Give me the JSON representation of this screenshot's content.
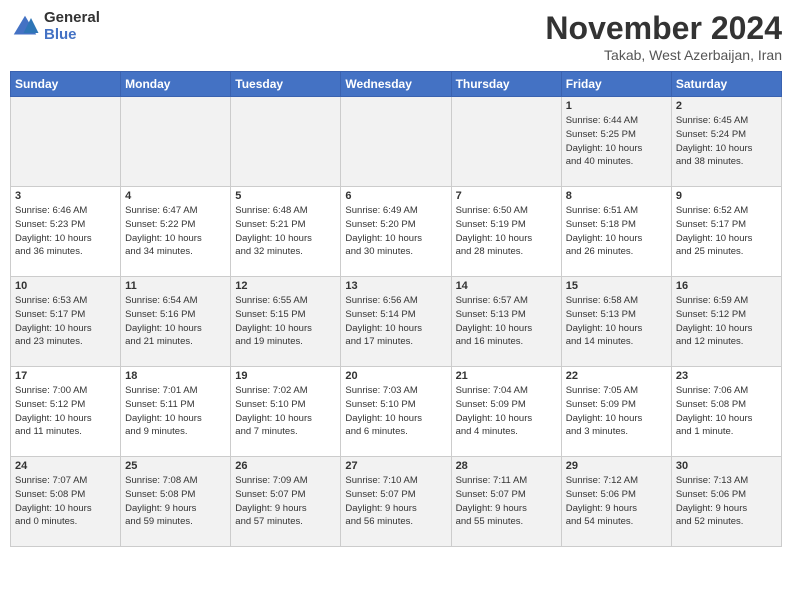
{
  "header": {
    "logo_line1": "General",
    "logo_line2": "Blue",
    "month": "November 2024",
    "location": "Takab, West Azerbaijan, Iran"
  },
  "weekdays": [
    "Sunday",
    "Monday",
    "Tuesday",
    "Wednesday",
    "Thursday",
    "Friday",
    "Saturday"
  ],
  "weeks": [
    [
      {
        "day": "",
        "info": ""
      },
      {
        "day": "",
        "info": ""
      },
      {
        "day": "",
        "info": ""
      },
      {
        "day": "",
        "info": ""
      },
      {
        "day": "",
        "info": ""
      },
      {
        "day": "1",
        "info": "Sunrise: 6:44 AM\nSunset: 5:25 PM\nDaylight: 10 hours\nand 40 minutes."
      },
      {
        "day": "2",
        "info": "Sunrise: 6:45 AM\nSunset: 5:24 PM\nDaylight: 10 hours\nand 38 minutes."
      }
    ],
    [
      {
        "day": "3",
        "info": "Sunrise: 6:46 AM\nSunset: 5:23 PM\nDaylight: 10 hours\nand 36 minutes."
      },
      {
        "day": "4",
        "info": "Sunrise: 6:47 AM\nSunset: 5:22 PM\nDaylight: 10 hours\nand 34 minutes."
      },
      {
        "day": "5",
        "info": "Sunrise: 6:48 AM\nSunset: 5:21 PM\nDaylight: 10 hours\nand 32 minutes."
      },
      {
        "day": "6",
        "info": "Sunrise: 6:49 AM\nSunset: 5:20 PM\nDaylight: 10 hours\nand 30 minutes."
      },
      {
        "day": "7",
        "info": "Sunrise: 6:50 AM\nSunset: 5:19 PM\nDaylight: 10 hours\nand 28 minutes."
      },
      {
        "day": "8",
        "info": "Sunrise: 6:51 AM\nSunset: 5:18 PM\nDaylight: 10 hours\nand 26 minutes."
      },
      {
        "day": "9",
        "info": "Sunrise: 6:52 AM\nSunset: 5:17 PM\nDaylight: 10 hours\nand 25 minutes."
      }
    ],
    [
      {
        "day": "10",
        "info": "Sunrise: 6:53 AM\nSunset: 5:17 PM\nDaylight: 10 hours\nand 23 minutes."
      },
      {
        "day": "11",
        "info": "Sunrise: 6:54 AM\nSunset: 5:16 PM\nDaylight: 10 hours\nand 21 minutes."
      },
      {
        "day": "12",
        "info": "Sunrise: 6:55 AM\nSunset: 5:15 PM\nDaylight: 10 hours\nand 19 minutes."
      },
      {
        "day": "13",
        "info": "Sunrise: 6:56 AM\nSunset: 5:14 PM\nDaylight: 10 hours\nand 17 minutes."
      },
      {
        "day": "14",
        "info": "Sunrise: 6:57 AM\nSunset: 5:13 PM\nDaylight: 10 hours\nand 16 minutes."
      },
      {
        "day": "15",
        "info": "Sunrise: 6:58 AM\nSunset: 5:13 PM\nDaylight: 10 hours\nand 14 minutes."
      },
      {
        "day": "16",
        "info": "Sunrise: 6:59 AM\nSunset: 5:12 PM\nDaylight: 10 hours\nand 12 minutes."
      }
    ],
    [
      {
        "day": "17",
        "info": "Sunrise: 7:00 AM\nSunset: 5:12 PM\nDaylight: 10 hours\nand 11 minutes."
      },
      {
        "day": "18",
        "info": "Sunrise: 7:01 AM\nSunset: 5:11 PM\nDaylight: 10 hours\nand 9 minutes."
      },
      {
        "day": "19",
        "info": "Sunrise: 7:02 AM\nSunset: 5:10 PM\nDaylight: 10 hours\nand 7 minutes."
      },
      {
        "day": "20",
        "info": "Sunrise: 7:03 AM\nSunset: 5:10 PM\nDaylight: 10 hours\nand 6 minutes."
      },
      {
        "day": "21",
        "info": "Sunrise: 7:04 AM\nSunset: 5:09 PM\nDaylight: 10 hours\nand 4 minutes."
      },
      {
        "day": "22",
        "info": "Sunrise: 7:05 AM\nSunset: 5:09 PM\nDaylight: 10 hours\nand 3 minutes."
      },
      {
        "day": "23",
        "info": "Sunrise: 7:06 AM\nSunset: 5:08 PM\nDaylight: 10 hours\nand 1 minute."
      }
    ],
    [
      {
        "day": "24",
        "info": "Sunrise: 7:07 AM\nSunset: 5:08 PM\nDaylight: 10 hours\nand 0 minutes."
      },
      {
        "day": "25",
        "info": "Sunrise: 7:08 AM\nSunset: 5:08 PM\nDaylight: 9 hours\nand 59 minutes."
      },
      {
        "day": "26",
        "info": "Sunrise: 7:09 AM\nSunset: 5:07 PM\nDaylight: 9 hours\nand 57 minutes."
      },
      {
        "day": "27",
        "info": "Sunrise: 7:10 AM\nSunset: 5:07 PM\nDaylight: 9 hours\nand 56 minutes."
      },
      {
        "day": "28",
        "info": "Sunrise: 7:11 AM\nSunset: 5:07 PM\nDaylight: 9 hours\nand 55 minutes."
      },
      {
        "day": "29",
        "info": "Sunrise: 7:12 AM\nSunset: 5:06 PM\nDaylight: 9 hours\nand 54 minutes."
      },
      {
        "day": "30",
        "info": "Sunrise: 7:13 AM\nSunset: 5:06 PM\nDaylight: 9 hours\nand 52 minutes."
      }
    ]
  ]
}
